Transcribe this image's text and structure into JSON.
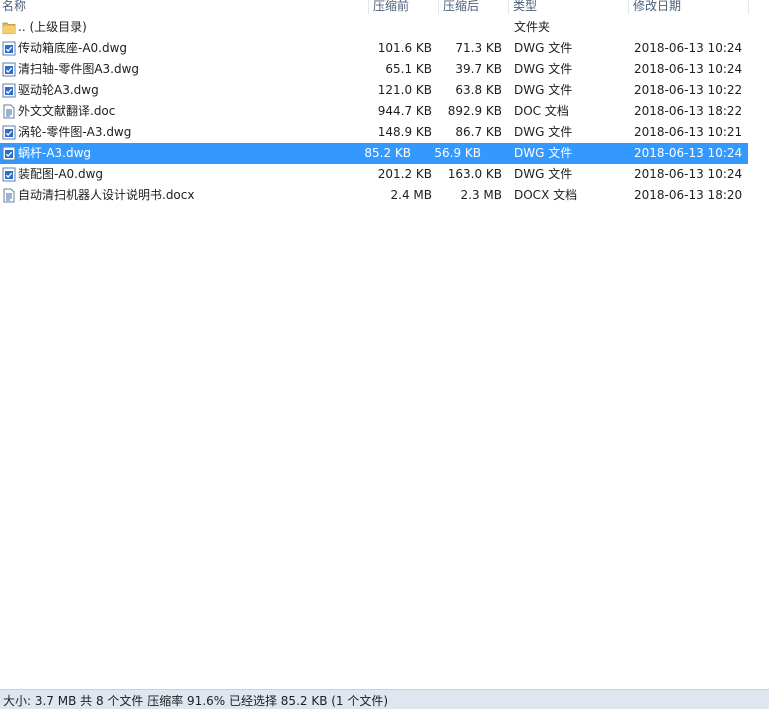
{
  "columns": {
    "name": "名称",
    "packed": "压缩前",
    "compressed": "压缩后",
    "type": "类型",
    "modified": "修改日期"
  },
  "rows": [
    {
      "icon": "folder-icon",
      "name": ".. (上级目录)",
      "packed": "",
      "compressed": "",
      "type": "文件夹",
      "modified": ""
    },
    {
      "icon": "dwg-file-icon",
      "name": "传动箱底座-A0.dwg",
      "packed": "101.6 KB",
      "compressed": "71.3 KB",
      "type": "DWG 文件",
      "modified": "2018-06-13 10:24"
    },
    {
      "icon": "dwg-file-icon",
      "name": "清扫轴-零件图A3.dwg",
      "packed": "65.1 KB",
      "compressed": "39.7 KB",
      "type": "DWG 文件",
      "modified": "2018-06-13 10:24"
    },
    {
      "icon": "dwg-file-icon",
      "name": "驱动轮A3.dwg",
      "packed": "121.0 KB",
      "compressed": "63.8 KB",
      "type": "DWG 文件",
      "modified": "2018-06-13 10:22"
    },
    {
      "icon": "doc-file-icon",
      "name": "外文文献翻译.doc",
      "packed": "944.7 KB",
      "compressed": "892.9 KB",
      "type": "DOC 文档",
      "modified": "2018-06-13 18:22"
    },
    {
      "icon": "dwg-file-icon",
      "name": "涡轮-零件图-A3.dwg",
      "packed": "148.9 KB",
      "compressed": "86.7 KB",
      "type": "DWG 文件",
      "modified": "2018-06-13 10:21"
    },
    {
      "icon": "dwg-file-icon",
      "name": "蜗杆-A3.dwg",
      "packed": "85.2 KB",
      "compressed": "56.9 KB",
      "type": "DWG 文件",
      "modified": "2018-06-13 10:24",
      "selected": true
    },
    {
      "icon": "dwg-file-icon",
      "name": "装配图-A0.dwg",
      "packed": "201.2 KB",
      "compressed": "163.0 KB",
      "type": "DWG 文件",
      "modified": "2018-06-13 10:24"
    },
    {
      "icon": "doc-file-icon",
      "name": "自动清扫机器人设计说明书.docx",
      "packed": "2.4 MB",
      "compressed": "2.3 MB",
      "type": "DOCX 文档",
      "modified": "2018-06-13 18:20"
    }
  ],
  "status": "大小: 3.7 MB 共 8 个文件 压缩率 91.6% 已经选择 85.2 KB (1 个文件)",
  "colors": {
    "selection": "#3399ff",
    "status_bg": "#dde6f1",
    "folder": "#e8b94a",
    "dwg_check": "#2a6fc9"
  }
}
